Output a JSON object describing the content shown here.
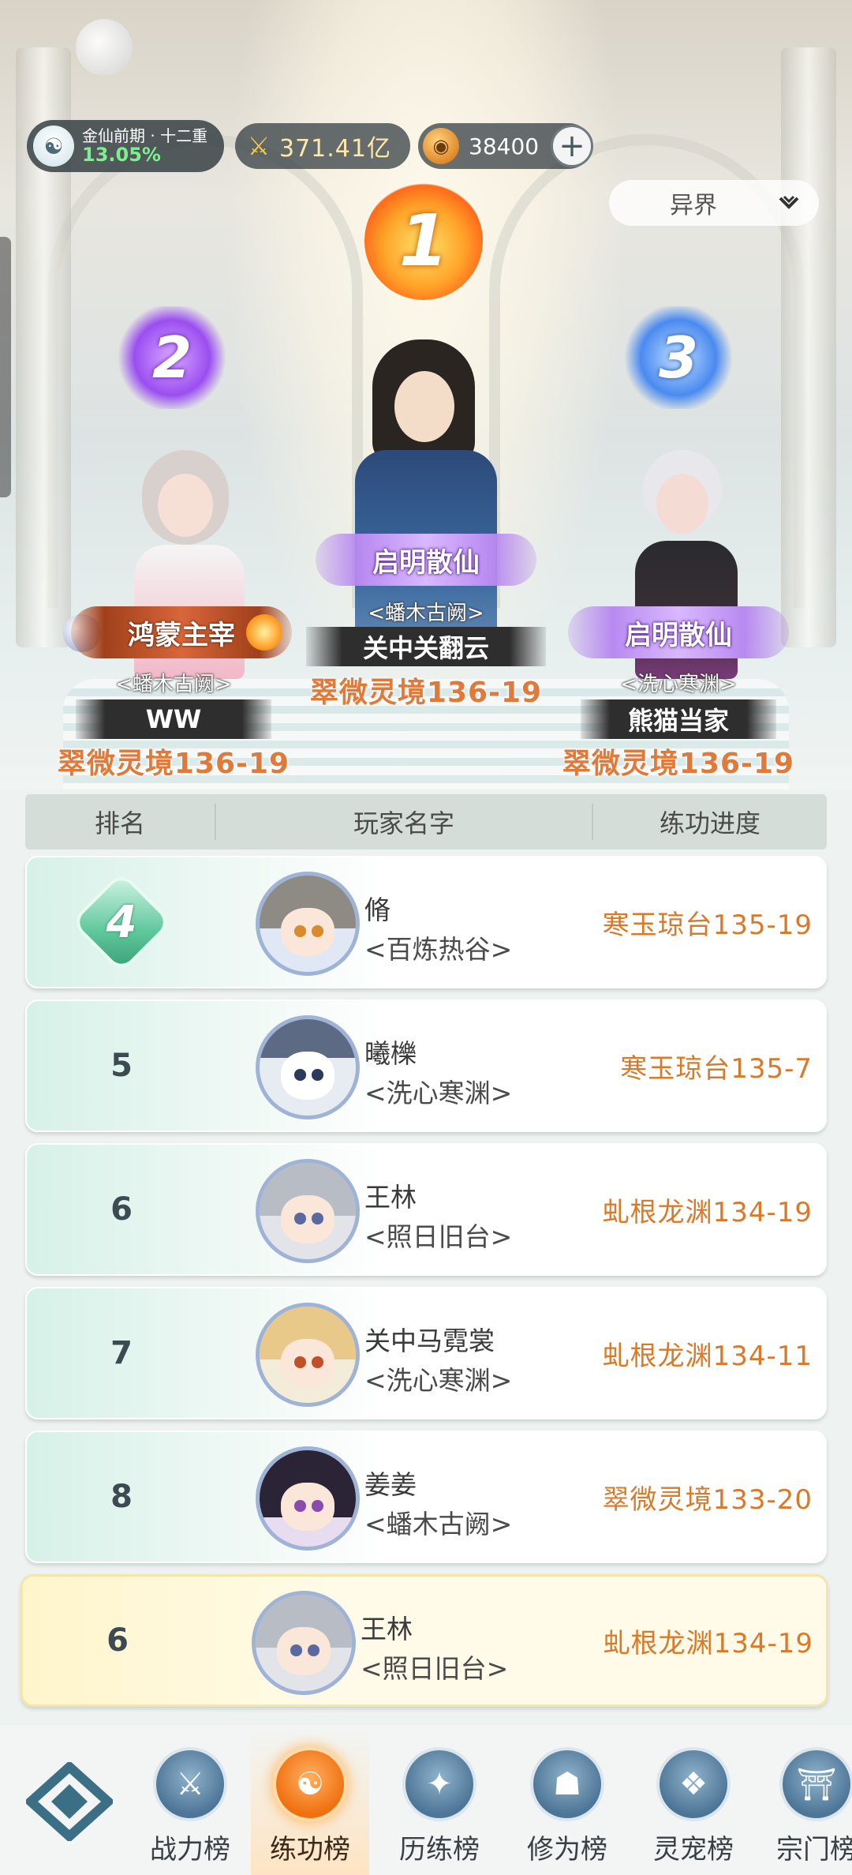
{
  "status_bar": {
    "realm_name": "金仙前期 · 十二重",
    "realm_progress": "13.05%",
    "power_value": "371.41亿",
    "currency_value": "38400",
    "world_select": "异界"
  },
  "podium": [
    {
      "rank": "1",
      "title": "启明散仙",
      "sect": "<蟠木古阙>",
      "name": "关中关翻云",
      "progress": "翠微灵境136-19"
    },
    {
      "rank": "2",
      "title": "鸿蒙主宰",
      "sect": "<蟠木古阙>",
      "name": "WW",
      "progress": "翠微灵境136-19"
    },
    {
      "rank": "3",
      "title": "启明散仙",
      "sect": "<洗心寒渊>",
      "name": "熊猫当家",
      "progress": "翠微灵境136-19"
    }
  ],
  "table": {
    "headers": {
      "rank": "排名",
      "name": "玩家名字",
      "progress": "练功进度"
    },
    "rows": [
      {
        "rank": "4",
        "name": "脩",
        "sect": "<百炼热谷>",
        "progress": "寒玉琼台135-19"
      },
      {
        "rank": "5",
        "name": "曦櫟",
        "sect": "<洗心寒渊>",
        "progress": "寒玉琼台135-7"
      },
      {
        "rank": "6",
        "name": "王林",
        "sect": "<照日旧台>",
        "progress": "虬根龙渊134-19"
      },
      {
        "rank": "7",
        "name": "关中马霓裳",
        "sect": "<洗心寒渊>",
        "progress": "虬根龙渊134-11"
      },
      {
        "rank": "8",
        "name": "姜姜",
        "sect": "<蟠木古阙>",
        "progress": "翠微灵境133-20"
      }
    ],
    "me": {
      "rank": "6",
      "name": "王林",
      "sect": "<照日旧台>",
      "progress": "虬根龙渊134-19"
    }
  },
  "nav": {
    "items": [
      {
        "label": "战力榜",
        "icon": "sword-icon"
      },
      {
        "label": "练功榜",
        "icon": "yin-yang-icon"
      },
      {
        "label": "历练榜",
        "icon": "compass-star-icon"
      },
      {
        "label": "修为榜",
        "icon": "cultivator-icon"
      },
      {
        "label": "灵宠榜",
        "icon": "pet-icon"
      },
      {
        "label": "宗门榜",
        "icon": "sect-gate-icon"
      }
    ],
    "active_index": 1
  },
  "colors": {
    "accent_orange": "#d87a2a",
    "progress_green": "#7cf08f",
    "rank4_green": "#5fc79c"
  }
}
